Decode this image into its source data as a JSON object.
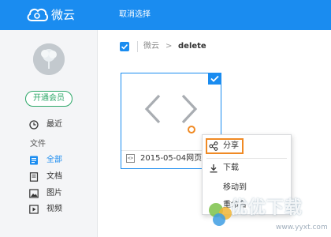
{
  "header": {
    "app_name": "微云",
    "cancel_selection": "取消选择",
    "logo_icon": "cloud-logo-icon",
    "accent_color": "#1a8cf0"
  },
  "sidebar": {
    "avatar_icon": "user-avatar",
    "vip_button": "开通会员",
    "section_label": "文件",
    "items": [
      {
        "label": "最近",
        "icon": "clock-icon",
        "active": false
      },
      {
        "label": "全部",
        "icon": "file-list-icon",
        "active": true
      },
      {
        "label": "文档",
        "icon": "document-icon",
        "active": false
      },
      {
        "label": "图片",
        "icon": "image-icon",
        "active": false
      },
      {
        "label": "视频",
        "icon": "video-icon",
        "active": false
      }
    ]
  },
  "breadcrumb": {
    "root": "微云",
    "separator": ">",
    "current": "delete"
  },
  "file": {
    "name": "2015-05-04网页截图",
    "type_badge": "<>",
    "selected": true
  },
  "context_menu": {
    "items": [
      {
        "label": "分享",
        "icon": "share-icon"
      },
      {
        "label": "下载",
        "icon": "download-icon"
      },
      {
        "label": "移动到",
        "icon": ""
      },
      {
        "label": "重命名",
        "icon": ""
      }
    ],
    "highlight_color": "#f08a24"
  },
  "watermark": {
    "text": "优优下载",
    "url": "www.yyxt.com"
  }
}
